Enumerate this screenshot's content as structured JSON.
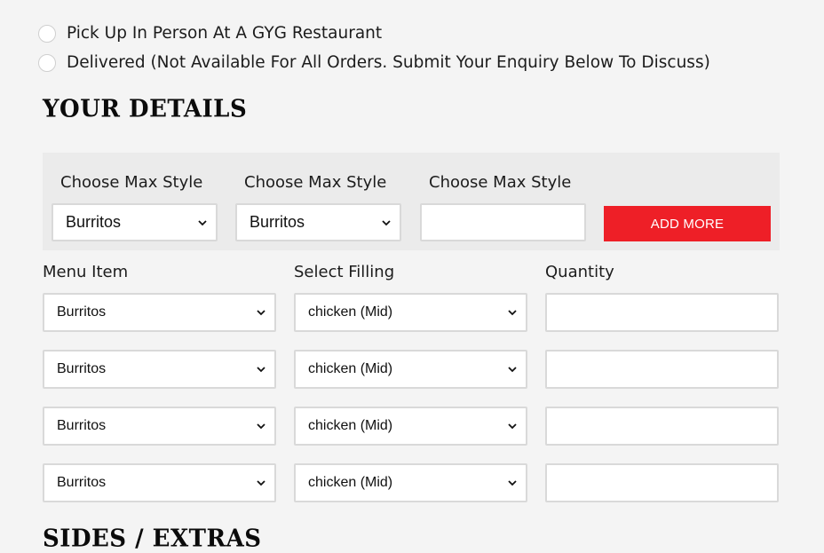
{
  "delivery_options": [
    {
      "label": "Pick Up In Person At A GYG Restaurant"
    },
    {
      "label": "Delivered (Not Available For All Orders. Submit Your Enquiry Below To Discuss)"
    }
  ],
  "details": {
    "heading": "YOUR DETAILS",
    "max_styles": [
      {
        "label": "Choose Max Style",
        "value": "Burritos"
      },
      {
        "label": "Choose Max Style",
        "value": "Burritos"
      },
      {
        "label": "Choose Max Style",
        "value": ""
      }
    ],
    "add_more_label": "ADD MORE"
  },
  "order": {
    "columns": {
      "menu_item": "Menu Item",
      "filling": "Select Filling",
      "quantity": "Quantity"
    },
    "rows": [
      {
        "menu_item": "Burritos",
        "filling": "chicken (Mid)",
        "quantity": ""
      },
      {
        "menu_item": "Burritos",
        "filling": "chicken (Mid)",
        "quantity": ""
      },
      {
        "menu_item": "Burritos",
        "filling": "chicken (Mid)",
        "quantity": ""
      },
      {
        "menu_item": "Burritos",
        "filling": "chicken (Mid)",
        "quantity": ""
      }
    ]
  },
  "sides": {
    "heading": "SIDES / EXTRAS"
  },
  "colors": {
    "accent": "#ee1f27",
    "background": "#f4f4f4",
    "heading": "#0b0b0b"
  }
}
